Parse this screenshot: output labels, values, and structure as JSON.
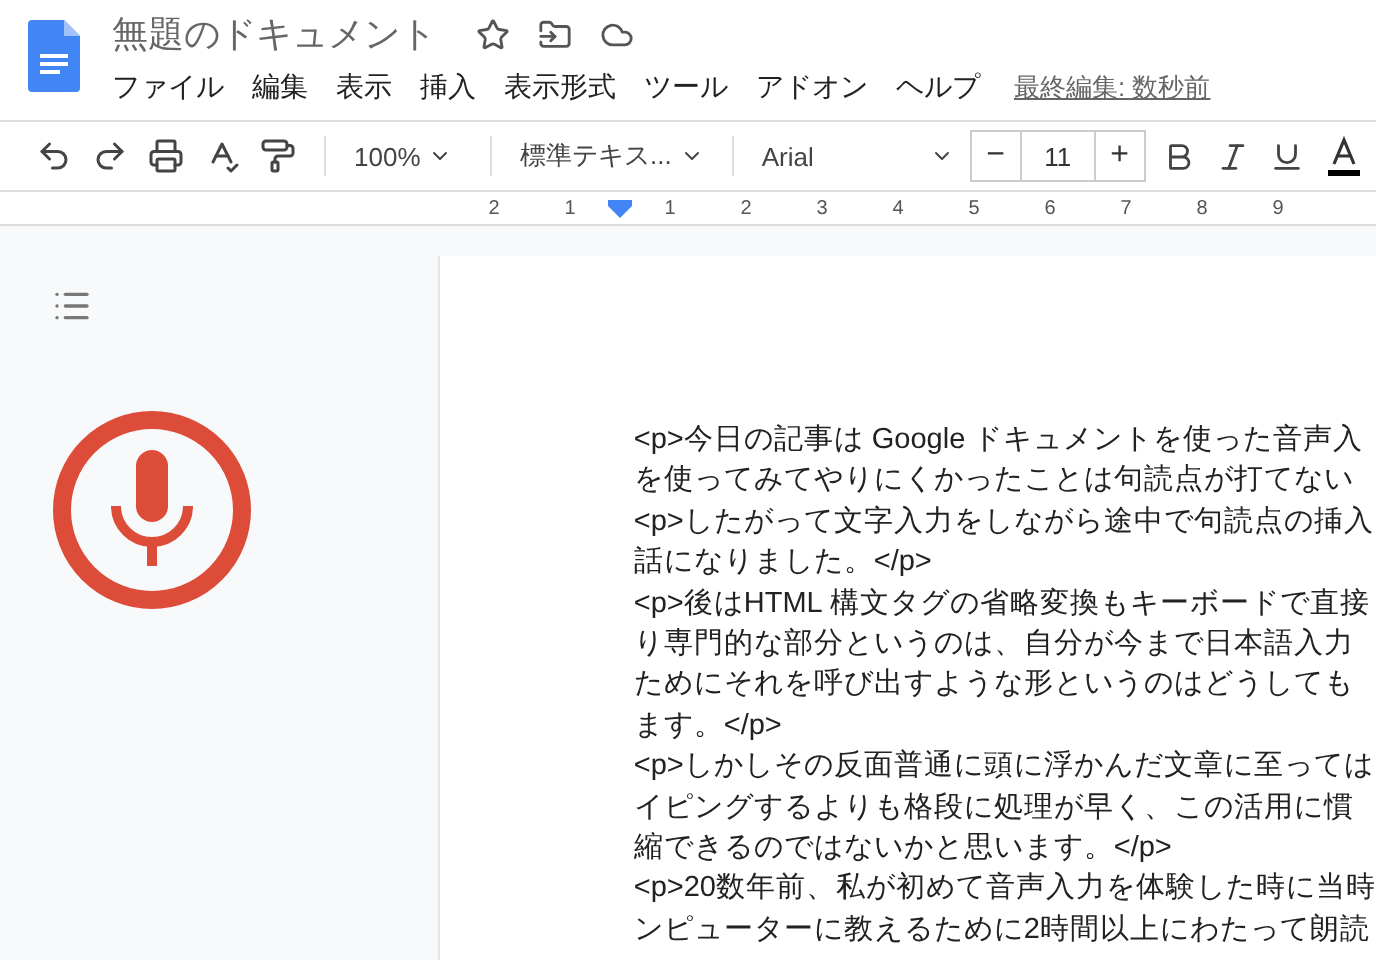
{
  "document": {
    "title": "無題のドキュメント"
  },
  "menu": [
    "ファイル",
    "編集",
    "表示",
    "挿入",
    "表示形式",
    "ツール",
    "アドオン",
    "ヘルプ"
  ],
  "last_edit": "最終編集: 数秒前",
  "toolbar": {
    "zoom": "100%",
    "style": "標準テキス...",
    "font": "Arial",
    "font_size": "11",
    "minus": "−",
    "plus": "+"
  },
  "ruler": {
    "left_marks": [
      "2",
      "1"
    ],
    "right_marks": [
      "1",
      "2",
      "3",
      "4",
      "5",
      "6",
      "7",
      "8",
      "9"
    ]
  },
  "voice_typing": {
    "listening": true
  },
  "body_lines": [
    "<p>今日の記事は Google ドキュメントを使った音声入",
    "を使ってみてやりにくかったことは句読点が打てない",
    "<p>したがって文字入力をしながら途中で句読点の挿入",
    "話になりました。</p>",
    "<p>後はHTML 構文タグの省略変換もキーボードで直接",
    "り専門的な部分というのは、自分が今まで日本語入力",
    "ためにそれを呼び出すような形というのはどうしても",
    "ます。</p>",
    "<p>しかしその反面普通に頭に浮かんだ文章に至っては",
    "イピングするよりも格段に処理が早く、この活用に慣",
    "縮できるのではないかと思います。</p>",
    "<p>20数年前、私が初めて音声入力を体験した時に当時",
    "ンピューターに教えるために2時間以上にわたって朗読"
  ]
}
